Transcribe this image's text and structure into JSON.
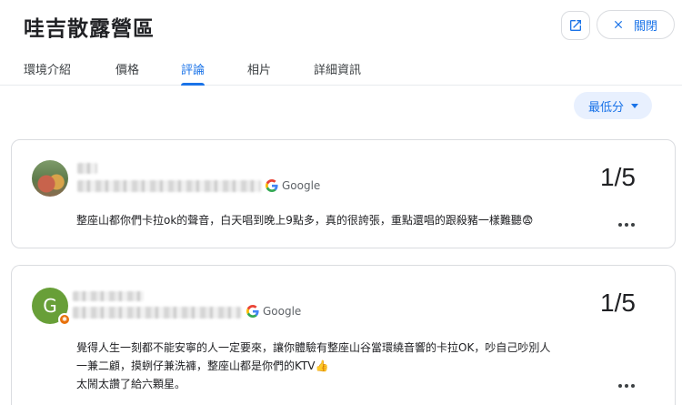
{
  "header": {
    "title": "哇吉散露營區",
    "close_label": "關閉"
  },
  "tabs": [
    {
      "label": "環境介紹",
      "active": false
    },
    {
      "label": "價格",
      "active": false
    },
    {
      "label": "評論",
      "active": true
    },
    {
      "label": "相片",
      "active": false
    },
    {
      "label": "詳細資訊",
      "active": false
    }
  ],
  "sort": {
    "label": "最低分"
  },
  "reviews": [
    {
      "avatar": "photo-avatar",
      "source": "Google",
      "score": "1/5",
      "text_lines": [
        "整座山都你們卡拉ok的聲音，白天唱到晚上9點多，真的很誇張，重點還唱的跟殺豬一樣難聽😨"
      ]
    },
    {
      "avatar_letter": "G",
      "source": "Google",
      "score": "1/5",
      "text_lines": [
        "覺得人生一刻都不能安寧的人一定要來，讓你體驗有整座山谷當環繞音響的卡拉OK，吵自己吵別人",
        "一兼二顧，摸蛚仔兼洗褲，整座山都是你們的KTV👍",
        "太鬧太讚了給六顆星。"
      ]
    }
  ],
  "colors": {
    "accent": "#1a73e8",
    "border": "#dadce0",
    "avatar_g": "#689f38",
    "badge": "#e8710a"
  }
}
